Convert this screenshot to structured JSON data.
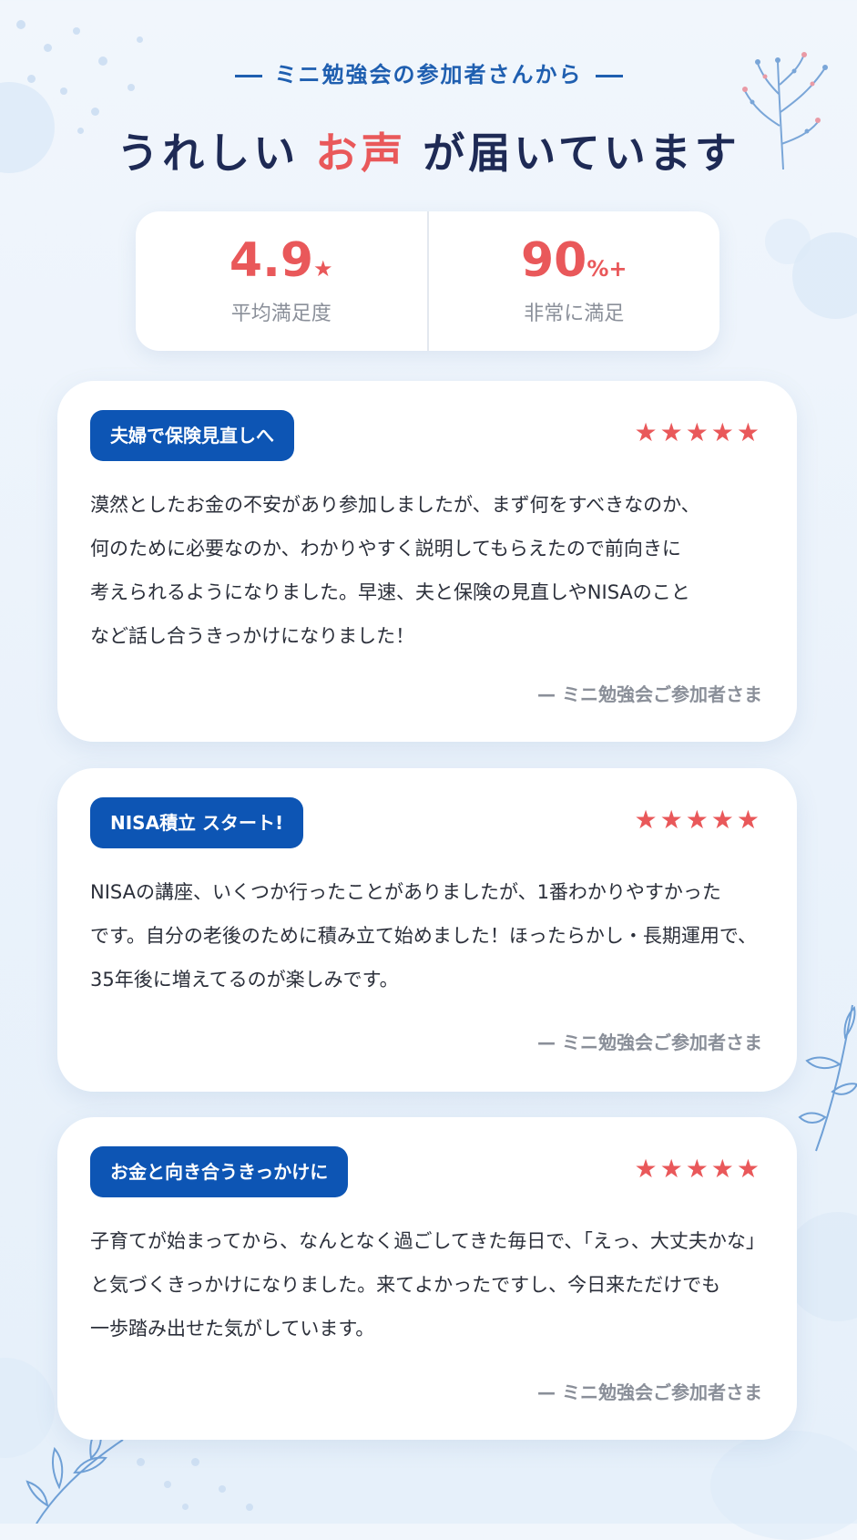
{
  "header": {
    "eyebrow": "ミニ勉強会の参加者さんから",
    "headline_pre": "うれしい",
    "headline_highlight": "お声",
    "headline_post": "が届いています"
  },
  "stats": [
    {
      "value": "4.9",
      "suffix": "★",
      "label": "平均満足度"
    },
    {
      "value": "90",
      "suffix": "%+",
      "label": "非常に満足"
    }
  ],
  "reviews": [
    {
      "tag": "夫婦で保険見直しへ",
      "rating": "★★★★★",
      "lines": [
        "漠然としたお金の不安があり参加しましたが、まず何をすべきなのか、",
        "何のために必要なのか、わかりやすく説明してもらえたので前向きに",
        "考えられるようになりました。早速、夫と保険の見直しやNISAのこと",
        "など話し合うきっかけになりました！"
      ],
      "signature": "— ミニ勉強会ご参加者さま"
    },
    {
      "tag": "NISA積立 スタート!",
      "rating": "★★★★★",
      "lines": [
        "NISAの講座、いくつか行ったことがありましたが、1番わかりやすかった",
        "です。自分の老後のために積み立て始めました！ほったらかし・長期運用で、",
        "35年後に増えてるのが楽しみです。"
      ],
      "signature": "— ミニ勉強会ご参加者さま"
    },
    {
      "tag": "お金と向き合うきっかけに",
      "rating": "★★★★★",
      "lines": [
        "子育てが始まってから、なんとなく過ごしてきた毎日で、「えっ、大丈夫かな」",
        "と気づくきっかけになりました。来てよかったですし、今日来ただけでも",
        "一歩踏み出せた気がしています。"
      ],
      "signature": "— ミニ勉強会ご参加者さま"
    }
  ],
  "colors": {
    "accent": "#e9585a",
    "tag_bg": "#0d55b4",
    "heading": "#1e2a55",
    "eyebrow": "#1f5fb0"
  },
  "icons": {
    "stars": "star-icon",
    "decor_top_right": "branch-icon",
    "decor_right": "leaf-icon",
    "decor_bottom_left": "leaf-icon"
  }
}
